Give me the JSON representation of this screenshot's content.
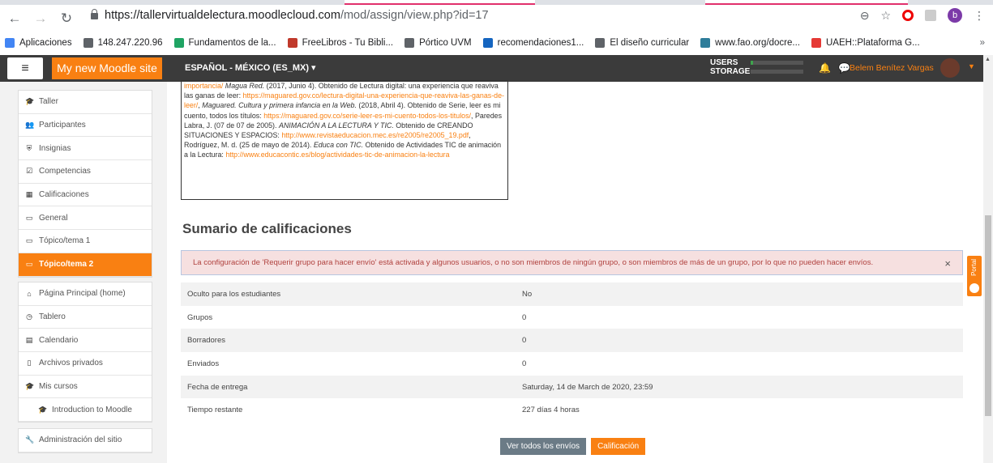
{
  "browser": {
    "url_host": "https://tallervirtualdelectura.moodlecloud.com",
    "url_path": "/mod/assign/view.php?id=17",
    "profile_initial": "b",
    "bookmarks": [
      {
        "label": "Aplicaciones",
        "color": "#4285f4"
      },
      {
        "label": "148.247.220.96",
        "color": "#5f6368"
      },
      {
        "label": "Fundamentos de la...",
        "color": "#1fa463"
      },
      {
        "label": "FreeLibros - Tu Bibli...",
        "color": "#c0392b"
      },
      {
        "label": "Pórtico UVM",
        "color": "#5f6368"
      },
      {
        "label": "recomendaciones1...",
        "color": "#1565c0"
      },
      {
        "label": "El diseño curricular",
        "color": "#5f6368"
      },
      {
        "label": "www.fao.org/docre...",
        "color": "#2e7d9a"
      },
      {
        "label": "UAEH::Plataforma G...",
        "color": "#e53935"
      }
    ],
    "overflow": "»"
  },
  "moodle": {
    "menu_icon": "≡",
    "site_name": "My new Moodle site",
    "language": "ESPAÑOL - MÉXICO (ES_MX) ▾",
    "users_label": "USERS",
    "storage_label": "STORAGE",
    "user_name": "Belem Benítez Vargas",
    "accent": "#f98012"
  },
  "sidebar": {
    "course_items": [
      {
        "label": "Taller",
        "icon": "graduation-cap-icon",
        "glyph": "🎓"
      },
      {
        "label": "Participantes",
        "icon": "users-icon",
        "glyph": "👥"
      },
      {
        "label": "Insignias",
        "icon": "shield-icon",
        "glyph": "⛨"
      },
      {
        "label": "Competencias",
        "icon": "checkbox-icon",
        "glyph": "☑"
      },
      {
        "label": "Calificaciones",
        "icon": "table-icon",
        "glyph": "▦"
      },
      {
        "label": "General",
        "icon": "folder-icon",
        "glyph": "▭"
      },
      {
        "label": "Tópico/tema 1",
        "icon": "folder-icon",
        "glyph": "▭"
      },
      {
        "label": "Tópico/tema 2",
        "icon": "folder-icon",
        "glyph": "▭",
        "active": true
      }
    ],
    "site_items": [
      {
        "label": "Página Principal (home)",
        "icon": "home-icon",
        "glyph": "⌂"
      },
      {
        "label": "Tablero",
        "icon": "dashboard-icon",
        "glyph": "◷"
      },
      {
        "label": "Calendario",
        "icon": "calendar-icon",
        "glyph": "▤"
      },
      {
        "label": "Archivos privados",
        "icon": "file-icon",
        "glyph": "▯"
      },
      {
        "label": "Mis cursos",
        "icon": "graduation-cap-icon",
        "glyph": "🎓"
      },
      {
        "label": "Introduction to Moodle",
        "icon": "graduation-cap-icon",
        "glyph": "🎓",
        "indent": true
      }
    ],
    "admin_item": {
      "label": "Administración del sitio",
      "icon": "wrench-icon",
      "glyph": "🔧"
    }
  },
  "references": {
    "p1": "importancia/",
    "p2": " Magua Red.",
    "p3": " (2017, Junio 4). Obtenido de  Lectura digital: una experiencia que reaviva las ganas de leer: ",
    "link1": "https://maguared.gov.co/lectura-digital-una-experiencia-que-reaviva-las-ganas-de-leer/",
    "p4": ", ",
    "p5": "Maguared. Cultura y primera infancia en la Web.",
    "p6": " (2018, Abril 4). Obtenido de Serie, leer es mi cuento, todos los títulos: ",
    "link2": "https://maguared.gov.co/serie-leer-es-mi-cuento-todos-los-titulos/",
    "p7": ", Paredes Labra, J. (07 de 07 de 2005). ",
    "p8": "ANIMACIÓN A LA LECTURA Y TIC.",
    "p9": " Obtenido de CREANDO SITUACIONES Y ESPACIOS: ",
    "link3": "http://www.revistaeducacion.mec.es/re2005/re2005_19.pdf",
    "p10": ", Rodríguez, M. d. (25 de mayo de 2014). ",
    "p11": "Educa con TIC.",
    "p12": " Obtenido de Actividades TIC de animación a la Lectura: ",
    "link4": "http://www.educacontic.es/blog/actividades-tic-de-animacion-la-lectura"
  },
  "summary": {
    "heading": "Sumario de calificaciones",
    "alert": "La configuración de 'Requerir grupo para hacer envío' está activada y algunos usuarios, o no son miembros de ningún grupo, o son miembros de más de un grupo, por lo que no pueden hacer envíos.",
    "close": "×",
    "rows": [
      {
        "label": "Oculto para los estudiantes",
        "value": "No"
      },
      {
        "label": "Grupos",
        "value": "0"
      },
      {
        "label": "Borradores",
        "value": "0"
      },
      {
        "label": "Enviados",
        "value": "0"
      },
      {
        "label": "Fecha de entrega",
        "value": "Saturday, 14 de March de 2020, 23:59"
      },
      {
        "label": "Tiempo restante",
        "value": "227 días 4 horas"
      }
    ],
    "btn_view_all": "Ver todos los envíos",
    "btn_grade": "Calificación"
  },
  "feedback_tab": "Portal"
}
